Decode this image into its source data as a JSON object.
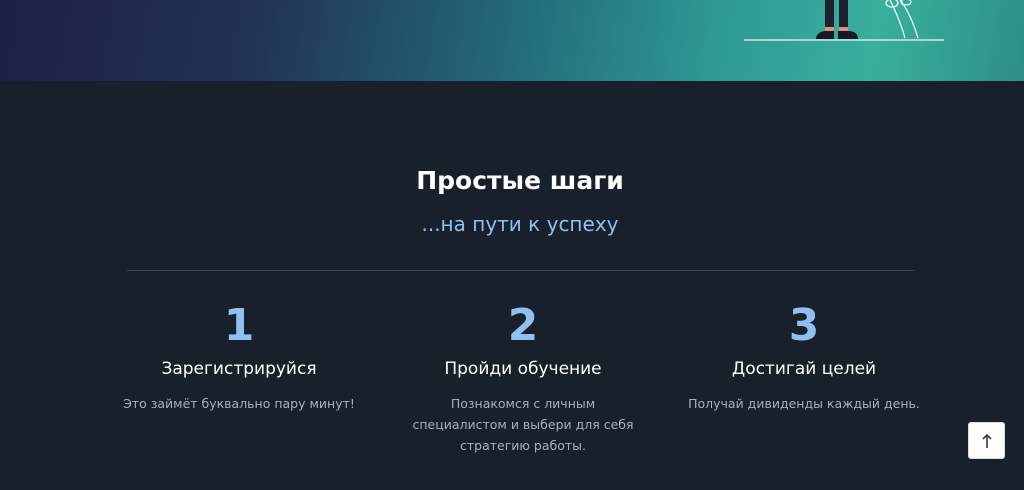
{
  "section": {
    "title": "Простые шаги",
    "subtitle": "...на пути к успеху"
  },
  "steps": [
    {
      "number": "1",
      "title": "Зарегистрируйся",
      "description": "Это займёт буквально пару минут!"
    },
    {
      "number": "2",
      "title": "Пройди обучение",
      "description": "Познакомся с личным специалистом и выбери для себя стратегию работы."
    },
    {
      "number": "3",
      "title": "Достигай целей",
      "description": "Получай дивиденды каждый день."
    }
  ],
  "scroll_top": {
    "icon": "arrow-up-icon"
  },
  "colors": {
    "background": "#17202b",
    "accent": "#8fc0f0",
    "hero_gradient_start": "#1f1f45",
    "hero_gradient_end": "#3aaf9d"
  }
}
